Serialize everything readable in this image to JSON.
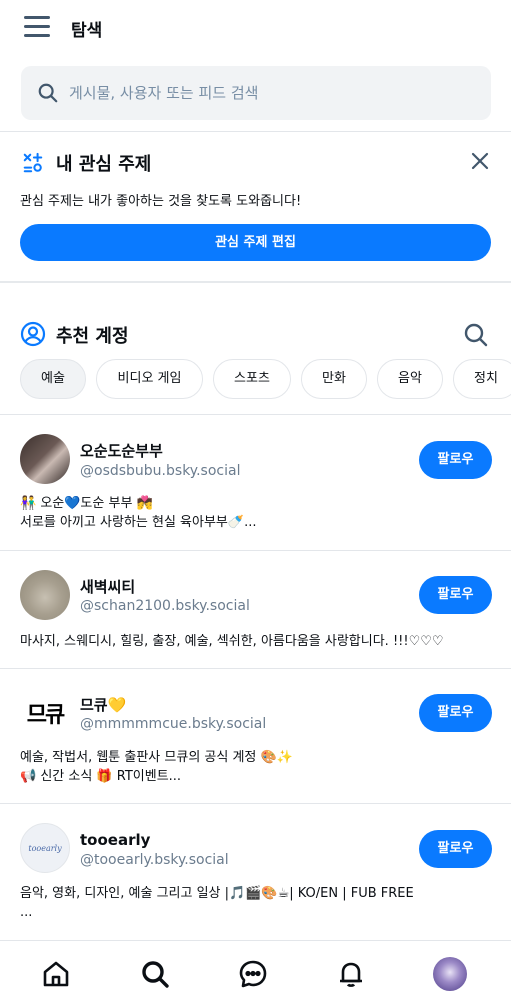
{
  "header": {
    "title": "탐색",
    "menu_icon": "hamburger-menu-icon"
  },
  "search": {
    "placeholder": "게시물, 사용자 또는 피드 검색",
    "icon": "search-icon"
  },
  "interests": {
    "title": "내 관심 주제",
    "description": "관심 주제는 내가 좋아하는 것을 찾도록 도와줍니다!",
    "button_label": "관심 주제 편집",
    "icon": "interests-icon",
    "close_icon": "close-icon"
  },
  "recommended": {
    "title": "추천 계정",
    "icon": "user-circle-icon",
    "search_icon": "search-icon",
    "chips": [
      {
        "label": "예술",
        "active": true
      },
      {
        "label": "비디오 게임",
        "active": false
      },
      {
        "label": "스포츠",
        "active": false
      },
      {
        "label": "만화",
        "active": false
      },
      {
        "label": "음악",
        "active": false
      },
      {
        "label": "정치",
        "active": false
      }
    ]
  },
  "accounts": [
    {
      "name": "오순도순부부",
      "handle": "@osdsbubu.bsky.social",
      "follow_label": "팔로우",
      "bio_lines": [
        "👫 오순💙도순 부부 💏",
        "서로를 아끼고 사랑하는 현실 육아부부🍼..."
      ]
    },
    {
      "name": "새벽씨티",
      "handle": "@schan2100.bsky.social",
      "follow_label": "팔로우",
      "bio_lines": [
        "마사지, 스웨디시, 힐링, 출장, 예술, 섹쉬한, 아름다움을 사랑합니다. !!!♡♡♡"
      ]
    },
    {
      "name": "므큐💛",
      "handle": "@mmmmmcue.bsky.social",
      "follow_label": "팔로우",
      "avatar_text": "므큐",
      "bio_lines": [
        "예술, 작법서, 웹툰 출판사 므큐의 공식 계정 🎨✨",
        "📢 신간 소식  🎁 RT이벤트..."
      ]
    },
    {
      "name": "tooearly",
      "handle": "@tooearly.bsky.social",
      "follow_label": "팔로우",
      "avatar_text": "tooearly",
      "bio_lines": [
        "음악, 영화, 디자인, 예술 그리고 일상 |🎵🎬🎨☕| KO/EN | FUB FREE",
        "..."
      ]
    }
  ],
  "tabbar": {
    "icons": [
      "home-icon",
      "search-icon",
      "chat-icon",
      "bell-icon",
      "profile-avatar"
    ]
  },
  "colors": {
    "accent": "#0a7aff",
    "muted": "#6b7c8e",
    "background": "#ffffff"
  }
}
